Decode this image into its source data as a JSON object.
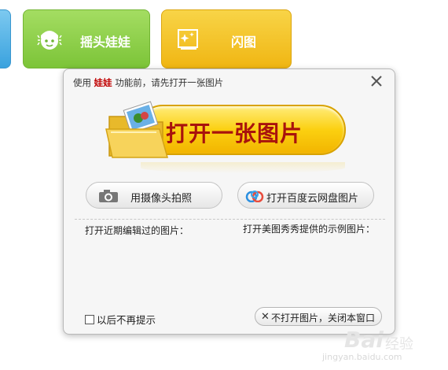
{
  "toolbar": {
    "tiles": [
      {
        "label": "摇头娃娃",
        "icon": "doll-face-icon",
        "color": "#8ad24a"
      },
      {
        "label": "闪图",
        "icon": "sparkle-image-icon",
        "color": "#f5c72a"
      }
    ]
  },
  "dialog": {
    "title_prefix": "使用",
    "title_highlight": "娃娃",
    "title_suffix": "功能前，请先打开一张图片",
    "open_image_label": "打开一张图片",
    "camera_label": "用摄像头拍照",
    "cloud_label": "打开百度云网盘图片",
    "recent_label": "打开近期编辑过的图片：",
    "samples_label": "打开美图秀秀提供的示例图片：",
    "dont_show_label": "以后不再提示",
    "close_dialog_label": "不打开图片，关闭本窗口",
    "close_x_glyph": "✕",
    "highlight_color": "#c00000",
    "accent_color": "#f5c72a"
  },
  "watermark": {
    "brand": "Bai",
    "sub": "经验",
    "url": "jingyan.baidu.com"
  }
}
